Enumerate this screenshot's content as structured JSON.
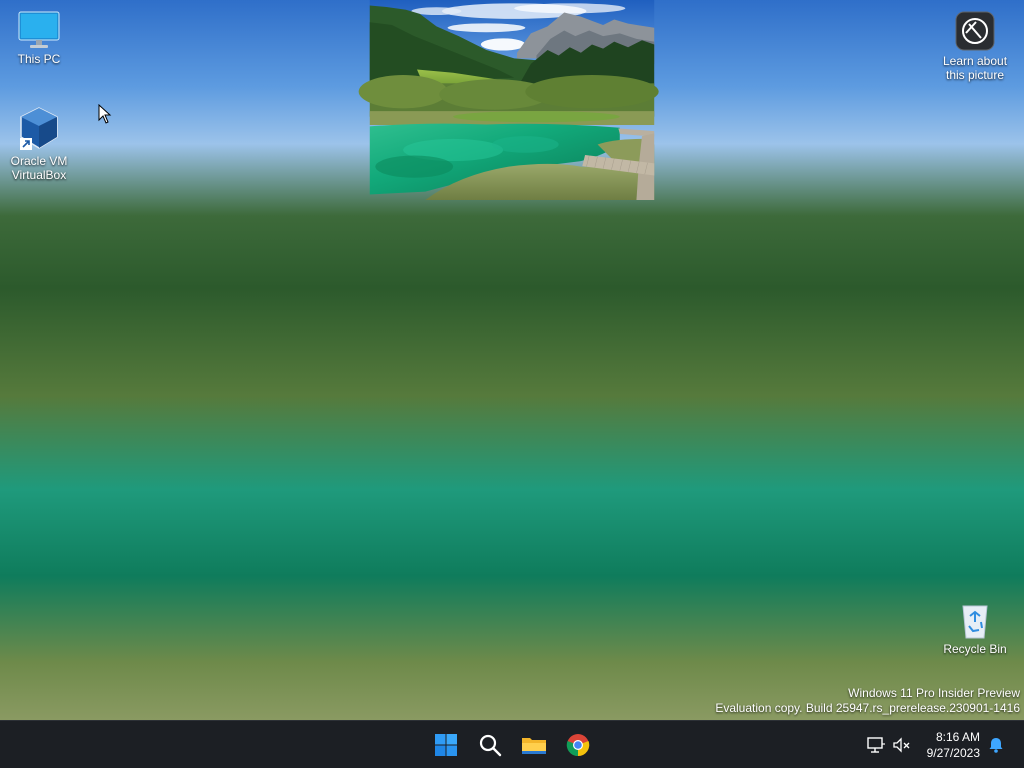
{
  "desktop": {
    "icons": [
      {
        "label": "This PC",
        "icon": "monitor-icon"
      },
      {
        "label": "Oracle VM VirtualBox",
        "icon": "virtualbox-icon"
      },
      {
        "label": "Learn about this picture",
        "icon": "camera-info-icon"
      },
      {
        "label": "Recycle Bin",
        "icon": "recycle-bin-icon"
      }
    ],
    "watermark": {
      "line1": "Windows 11 Pro Insider Preview",
      "line2": "Evaluation copy. Build 25947.rs_prerelease.230901-1416"
    }
  },
  "taskbar": {
    "apps": [
      {
        "name": "Start",
        "icon": "windows-start-icon"
      },
      {
        "name": "Search",
        "icon": "search-icon"
      },
      {
        "name": "File Explorer",
        "icon": "folder-icon"
      },
      {
        "name": "Google Chrome",
        "icon": "chrome-icon"
      }
    ],
    "tray": {
      "time": "8:16 AM",
      "date": "9/27/2023",
      "icons": [
        "network-icon",
        "volume-muted-icon",
        "notification-bell-icon"
      ]
    }
  },
  "colors": {
    "taskbar_bg": "#1c1f24",
    "start_blue": "#1e90ff",
    "bell_blue": "#3ea6ff"
  }
}
